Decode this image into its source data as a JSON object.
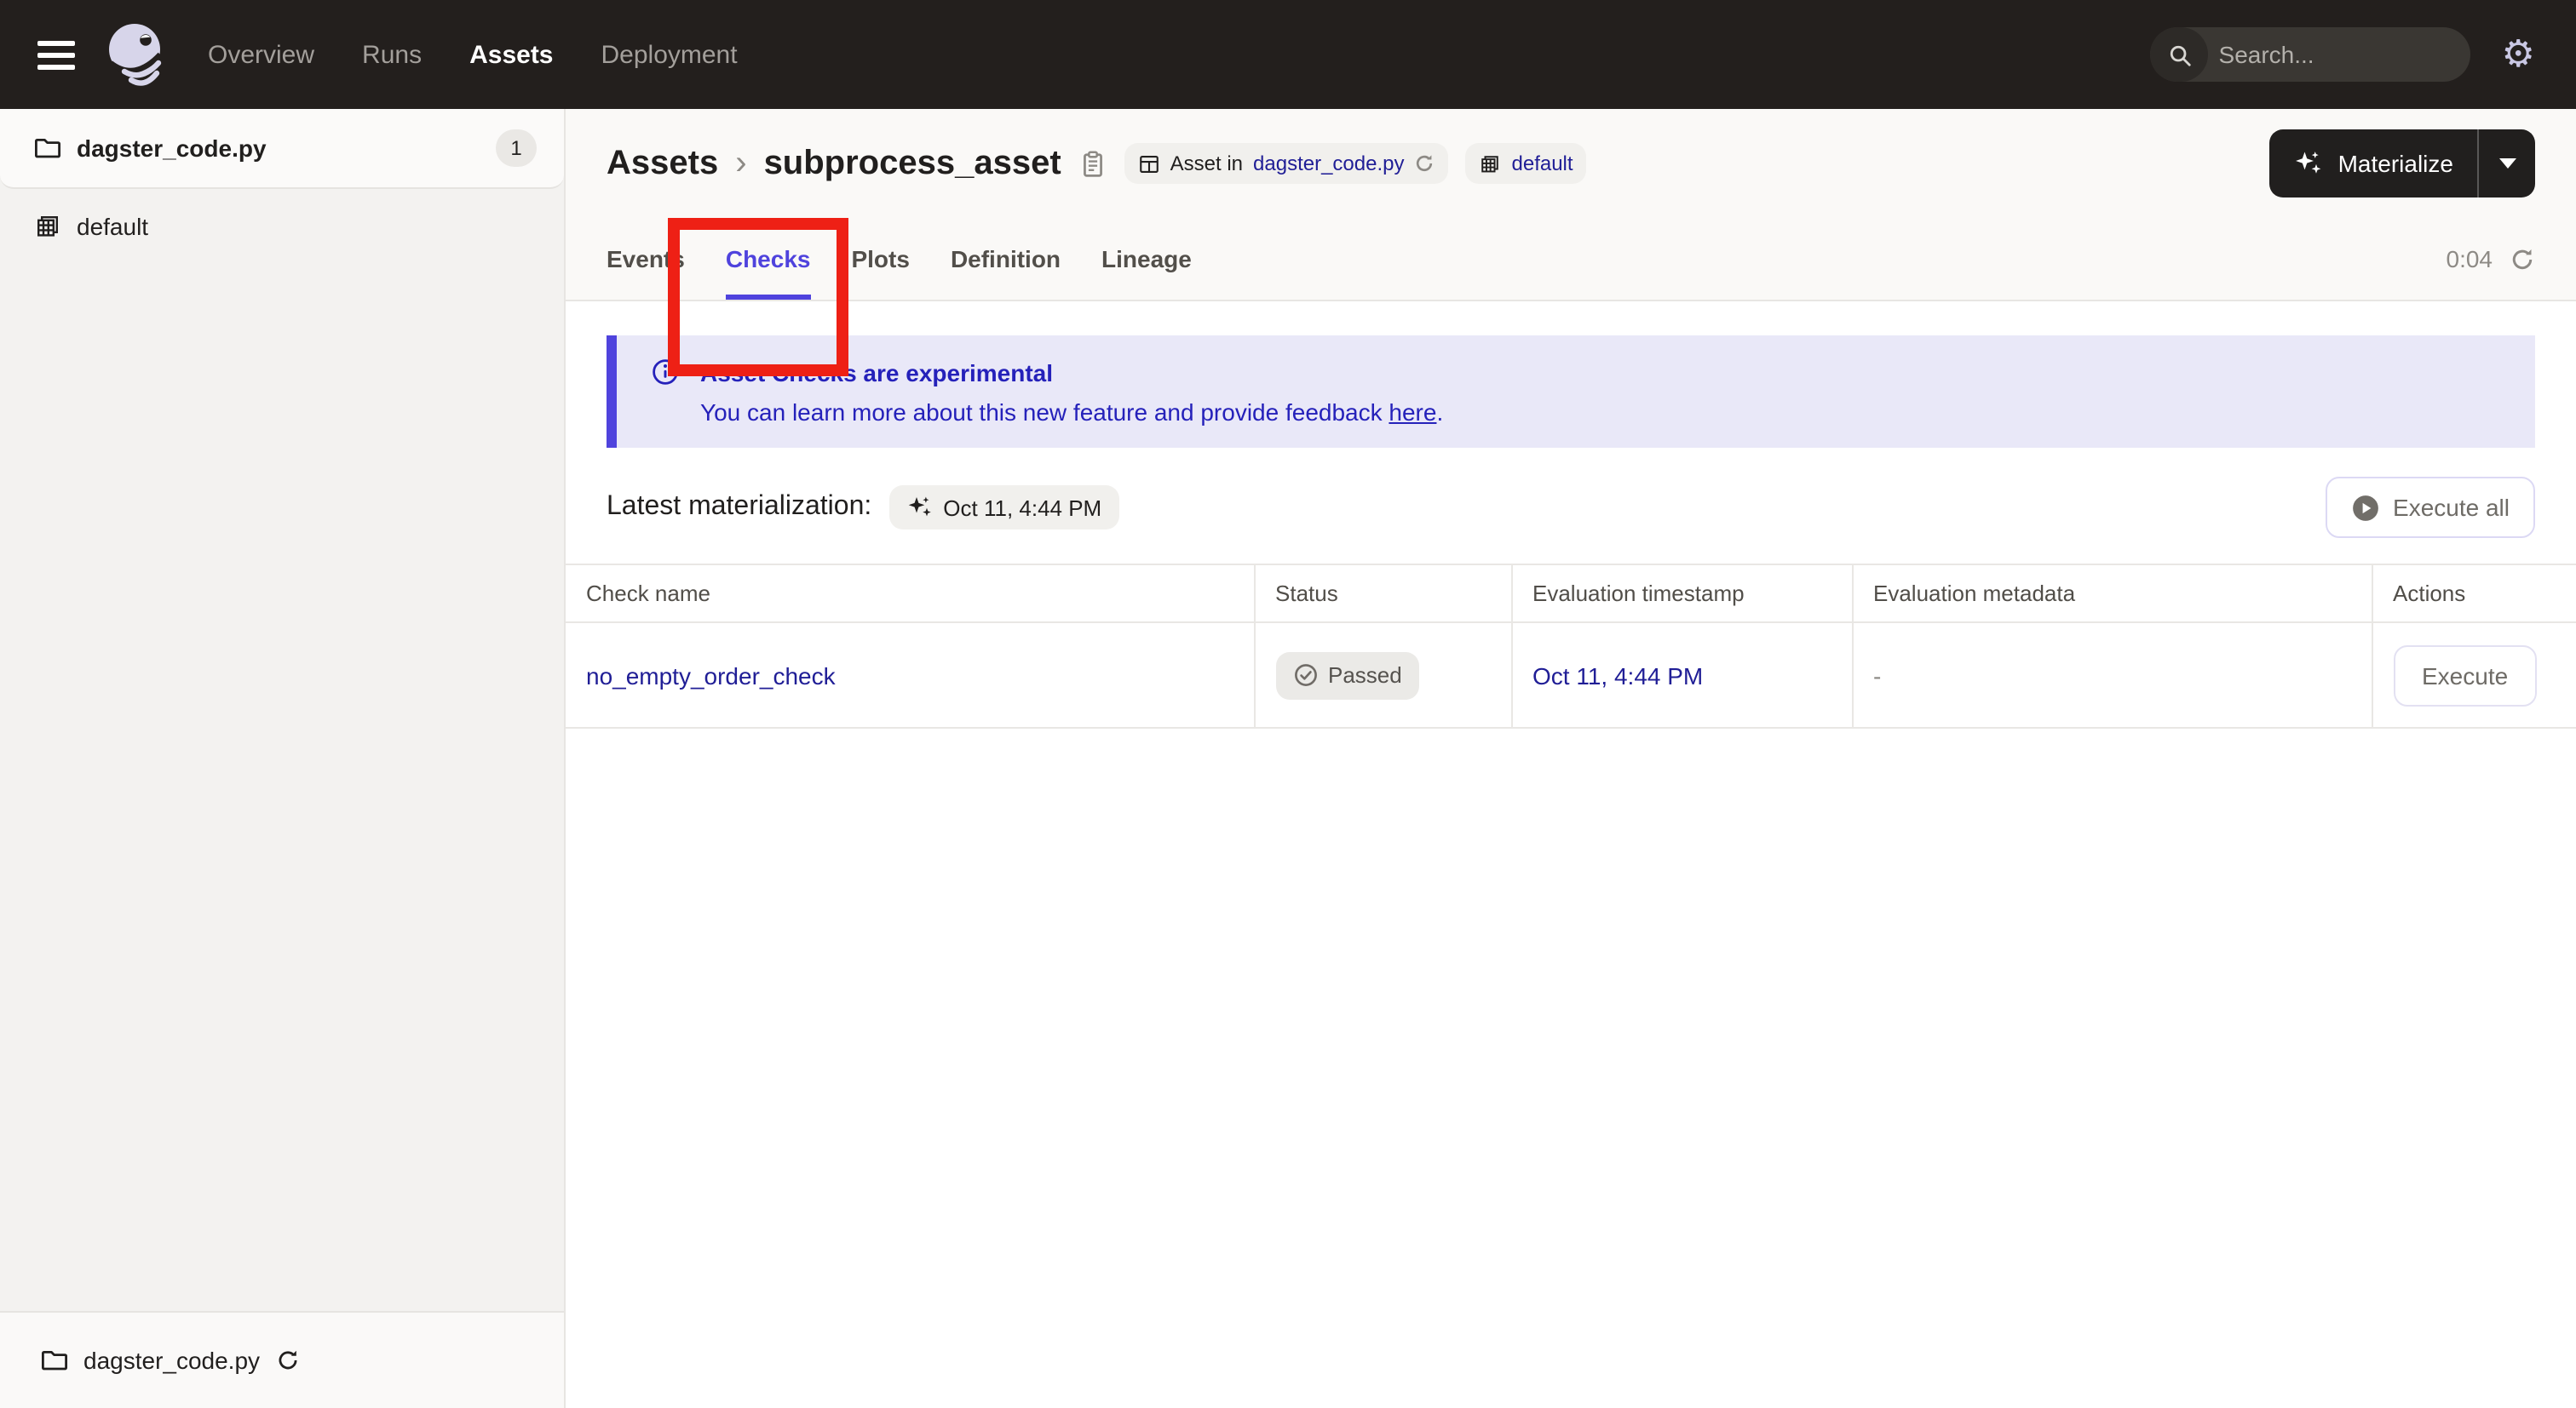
{
  "topnav": {
    "nav_items": [
      {
        "label": "Overview",
        "active": false
      },
      {
        "label": "Runs",
        "active": false
      },
      {
        "label": "Assets",
        "active": true
      },
      {
        "label": "Deployment",
        "active": false
      }
    ],
    "search": {
      "placeholder": "Search...",
      "shortcut_key": "/"
    },
    "settings_icon": "gear-icon"
  },
  "sidebar": {
    "top_item": {
      "label": "dagster_code.py",
      "count": "1",
      "icon": "folder-icon"
    },
    "sub_item": {
      "label": "default",
      "icon": "repo-grid-icon"
    },
    "bottom_item": {
      "label": "dagster_code.py",
      "icon": "folder-icon",
      "action_icon": "refresh-icon"
    }
  },
  "header": {
    "breadcrumb": {
      "root": "Assets",
      "separator": "›",
      "current": "subprocess_asset"
    },
    "asset_tag": {
      "prefix": "Asset in",
      "link": "dagster_code.py"
    },
    "group_tag": {
      "link": "default"
    },
    "materialize_button": {
      "label": "Materialize"
    }
  },
  "tabs": {
    "items": [
      {
        "label": "Events",
        "active": false
      },
      {
        "label": "Checks",
        "active": true
      },
      {
        "label": "Plots",
        "active": false
      },
      {
        "label": "Definition",
        "active": false
      },
      {
        "label": "Lineage",
        "active": false
      }
    ],
    "timer": "0:04"
  },
  "banner": {
    "title": "Asset Checks are experimental",
    "body": "You can learn more about this new feature and provide feedback ",
    "link_text": "here",
    "suffix": "."
  },
  "latest": {
    "label": "Latest materialization:",
    "value": "Oct 11, 4:44 PM",
    "execute_all_label": "Execute all"
  },
  "checks_table": {
    "columns": [
      "Check name",
      "Status",
      "Evaluation timestamp",
      "Evaluation metadata",
      "Actions"
    ],
    "rows": [
      {
        "name": "no_empty_order_check",
        "status": "Passed",
        "timestamp": "Oct 11, 4:44 PM",
        "metadata": "-",
        "action_label": "Execute"
      }
    ]
  },
  "annotation": {
    "shape": "rectangle",
    "target": "tab-checks",
    "color": "#ee2015"
  },
  "palette": {
    "accent_purple": "#4f43dd",
    "link_navy": "#201e96",
    "banner_bg": "#e9e8f8",
    "banner_text": "#2521ba",
    "topnav_bg": "#231f1d",
    "annotation_red": "#ee2015"
  }
}
